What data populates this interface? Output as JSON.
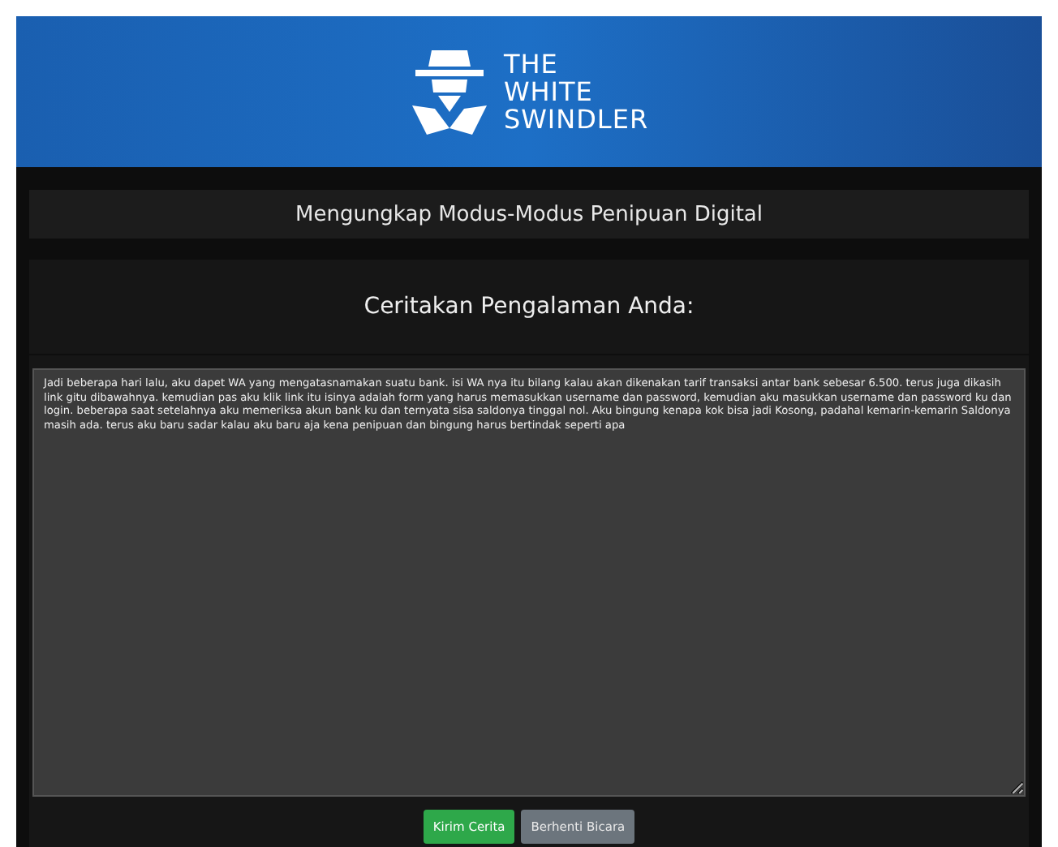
{
  "header": {
    "logo_lines": [
      "THE",
      "WHITE",
      "SWINDLER"
    ]
  },
  "subtitle": "Mengungkap Modus-Modus Penipuan Digital",
  "story_form": {
    "heading": "Ceritakan Pengalaman Anda:",
    "story": "Jadi beberapa hari lalu, aku dapet WA yang mengatasnamakan suatu bank. isi WA nya itu bilang kalau akan dikenakan tarif transaksi antar bank sebesar 6.500. terus juga dikasih link gitu dibawahnya. kemudian pas aku klik link itu isinya adalah form yang harus memasukkan username dan password, kemudian aku masukkan username dan password ku dan login. beberapa saat setelahnya aku memeriksa akun bank ku dan ternyata sisa saldonya tinggal nol. Aku bingung kenapa kok bisa jadi Kosong, padahal kemarin-kemarin Saldonya masih ada. terus aku baru sadar kalau aku baru aja kena penipuan dan bingung harus bertindak seperti apa",
    "buttons": [
      {
        "label": "Kirim Cerita",
        "kind": "primary"
      },
      {
        "label": "Berhenti Bicara",
        "kind": "secondary"
      }
    ]
  }
}
